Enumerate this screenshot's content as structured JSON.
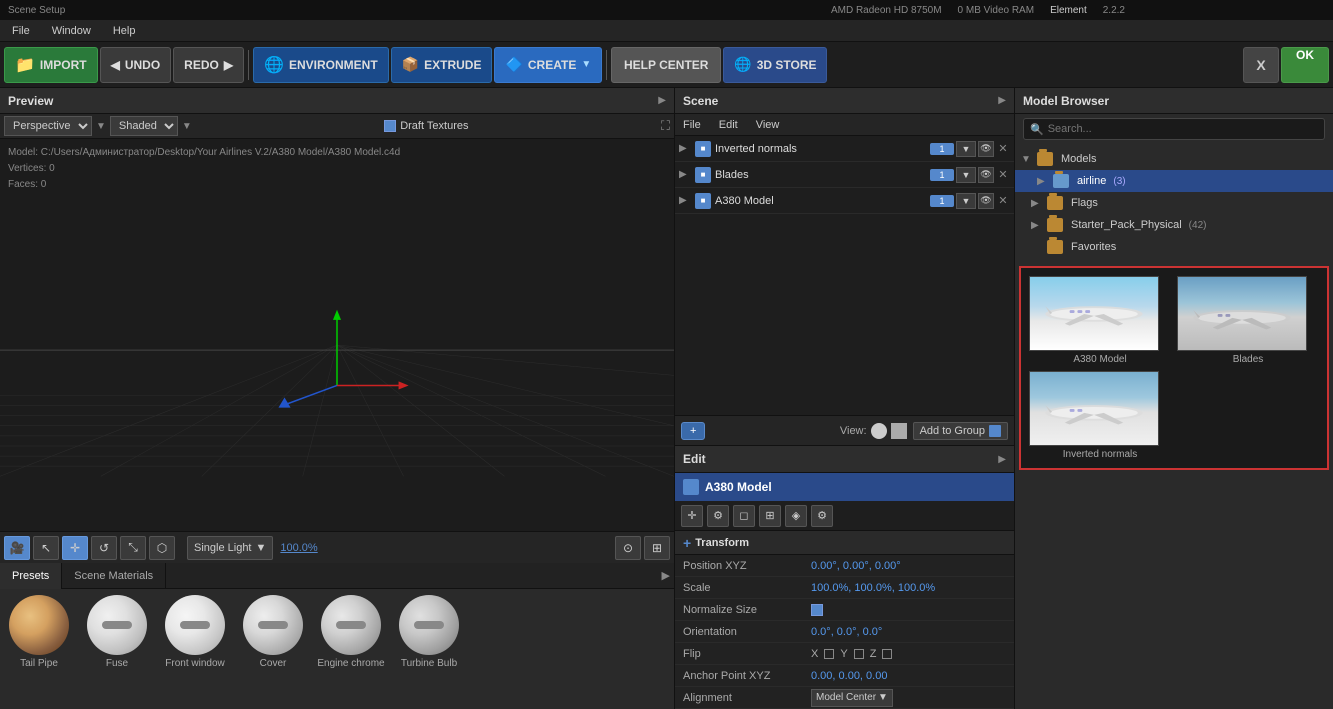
{
  "window": {
    "title": "Scene Setup",
    "gpu": "AMD Radeon HD 8750M",
    "vram": "0 MB Video RAM",
    "plugin": "Element",
    "version": "2.2.2"
  },
  "menu": {
    "items": [
      "File",
      "Window",
      "Help"
    ]
  },
  "toolbar": {
    "import_label": "IMPORT",
    "undo_label": "UNDO",
    "redo_label": "REDO",
    "environment_label": "ENVIRONMENT",
    "extrude_label": "EXTRUDE",
    "create_label": "CREATE",
    "help_label": "HELP CENTER",
    "store_label": "3D STORE",
    "cancel_label": "X",
    "ok_label": "OK"
  },
  "preview": {
    "title": "Preview",
    "draft_textures": "Draft Textures",
    "perspective": "Perspective",
    "shaded": "Shaded",
    "model_path": "Model: C:/Users/Администратор/Desktop/Your Airlines V.2/A380 Model/A380 Model.c4d",
    "vertices": "Vertices: 0",
    "faces": "Faces: 0"
  },
  "viewport_bottom": {
    "zoom": "100.0%",
    "light_mode": "Single Light"
  },
  "bottom_tabs": {
    "presets": "Presets",
    "scene_materials": "Scene Materials"
  },
  "materials": [
    {
      "name": "Tail Pipe",
      "color1": "#d4a060",
      "color2": "#8a6040"
    },
    {
      "name": "Fuse",
      "color1": "#e8e8e8",
      "color2": "#c0c0c0"
    },
    {
      "name": "Front window",
      "color1": "#e0e0e0",
      "color2": "#b0b0b0"
    },
    {
      "name": "Cover",
      "color1": "#d8d8d8",
      "color2": "#a8a8a8"
    },
    {
      "name": "Engine chrome",
      "color1": "#d0d0d0",
      "color2": "#909090"
    },
    {
      "name": "Turbine Bulb",
      "color1": "#c8c8c8",
      "color2": "#888888"
    }
  ],
  "scene": {
    "title": "Scene",
    "menu_items": [
      "File",
      "Edit",
      "View"
    ],
    "items": [
      {
        "name": "Inverted normals",
        "num": "1",
        "expanded": false
      },
      {
        "name": "Blades",
        "num": "1",
        "expanded": false
      },
      {
        "name": "A380 Model",
        "num": "1",
        "expanded": false
      }
    ],
    "view_label": "View:",
    "add_to_group": "Add to Group"
  },
  "edit": {
    "title": "Edit",
    "model_name": "A380 Model",
    "transform_title": "Transform",
    "position_label": "Position XYZ",
    "position_value": "0.00°,  0.00°,  0.00°",
    "scale_label": "Scale",
    "scale_value": "100.0%,  100.0%,  100.0%",
    "normalize_label": "Normalize Size",
    "orientation_label": "Orientation",
    "orientation_value": "0.0°,  0.0°,  0.0°",
    "flip_label": "Flip",
    "anchor_label": "Anchor Point XYZ",
    "anchor_value": "0.00,  0.00,  0.00",
    "alignment_label": "Alignment",
    "alignment_value": "Model Center"
  },
  "model_browser": {
    "title": "Model Browser",
    "search_placeholder": "Search...",
    "tree": {
      "models_label": "Models",
      "airline_label": "airline",
      "airline_count": "(3)",
      "flags_label": "Flags",
      "starter_label": "Starter_Pack_Physical",
      "starter_count": "(42)",
      "favorites_label": "Favorites"
    },
    "thumbnails": [
      {
        "name": "A380 Model"
      },
      {
        "name": "Blades"
      },
      {
        "name": "Inverted normals"
      }
    ]
  }
}
